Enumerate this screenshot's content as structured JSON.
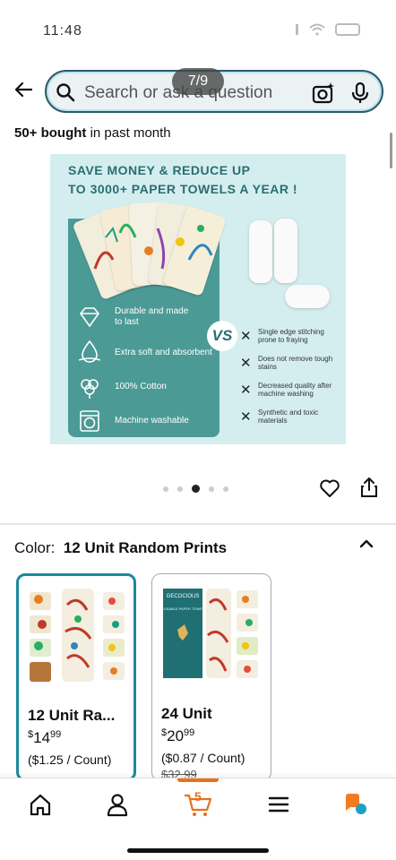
{
  "status_bar": {
    "time": "11:48"
  },
  "search": {
    "placeholder": "Search or ask a question",
    "image_counter": "7/9"
  },
  "purchase_info": {
    "count": "50+ bought",
    "suffix": " in past month"
  },
  "product_image": {
    "headline_line1": "SAVE MONEY & REDUCE UP",
    "headline_line2": "TO 3000+ PAPER TOWELS A YEAR !",
    "vs_label": "VS",
    "features": [
      {
        "icon": "diamond-icon",
        "label": "Durable and made\nto last"
      },
      {
        "icon": "droplet-icon",
        "label": "Extra soft and absorbent"
      },
      {
        "icon": "cotton-icon",
        "label": "100% Cotton"
      },
      {
        "icon": "washing-machine-icon",
        "label": "Machine washable"
      }
    ],
    "cons": [
      "Single edge stitching prone to fraying",
      "Does not remove tough stains",
      "Decreased quality after machine washing",
      "Synthetic and toxic materials"
    ]
  },
  "carousel": {
    "total": 5,
    "active_index": 2
  },
  "color_selector": {
    "label": "Color:",
    "selected_value": "12 Unit Random Prints",
    "options": [
      {
        "title": "12 Unit Ra...",
        "price_whole": "14",
        "price_fraction": "99",
        "price_currency": "$",
        "unit_price": "($1.25 / Count)",
        "selected": true
      },
      {
        "title": "24 Unit",
        "price_whole": "20",
        "price_fraction": "99",
        "price_currency": "$",
        "unit_price": "($0.87 / Count)",
        "list_price": "$32.99",
        "selected": false
      }
    ]
  },
  "packaging": {
    "brand": "GECOCIOUS",
    "product": "REUSABLE PAPER TOWELS"
  },
  "bottom_nav": {
    "cart_count": "5"
  },
  "colors": {
    "accent_teal": "#1a8a9c",
    "cart_orange": "#e8711a",
    "panel_teal": "#4b9a96"
  }
}
